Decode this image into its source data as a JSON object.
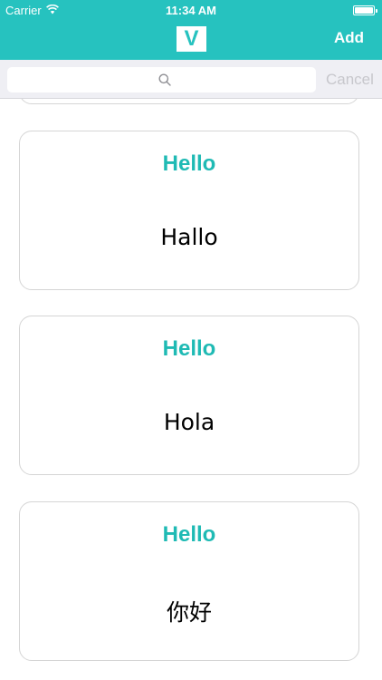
{
  "status_bar": {
    "carrier": "Carrier",
    "time": "11:34 AM"
  },
  "nav": {
    "logo_letter": "V",
    "add_label": "Add"
  },
  "search": {
    "placeholder": "",
    "cancel_label": "Cancel"
  },
  "cards": [
    {
      "title": "Hello",
      "translation": "Hallo"
    },
    {
      "title": "Hello",
      "translation": "Hola"
    },
    {
      "title": "Hello",
      "translation": "你好"
    }
  ],
  "colors": {
    "accent": "#26c2bf",
    "title_text": "#1fbab4",
    "cancel_text": "#c7c7cc"
  }
}
